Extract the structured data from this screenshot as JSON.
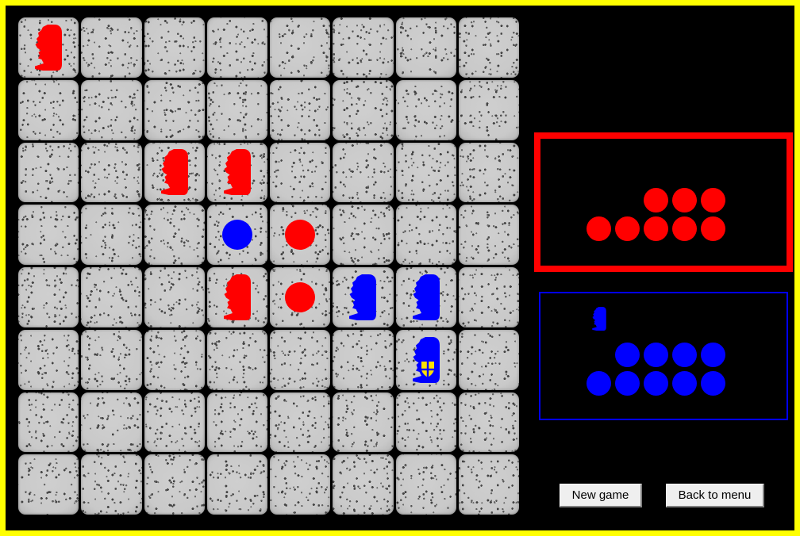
{
  "window": {
    "title": "Moai Board Game",
    "background_color": "#000000",
    "frame_color": "#ffff00"
  },
  "board": {
    "name": "game-board",
    "rows": 8,
    "columns": 8,
    "tile_color": "#c9c9c9",
    "tile_texture": "speckled-stone",
    "cells": [
      [
        {
          "piece": "moai",
          "color": "red"
        },
        null,
        null,
        null,
        null,
        null,
        null,
        null
      ],
      [
        null,
        null,
        null,
        null,
        null,
        null,
        null,
        null
      ],
      [
        null,
        null,
        {
          "piece": "moai",
          "color": "red"
        },
        {
          "piece": "moai",
          "color": "red"
        },
        null,
        null,
        null,
        null
      ],
      [
        null,
        null,
        null,
        {
          "piece": "disc",
          "color": "blue"
        },
        {
          "piece": "disc",
          "color": "red"
        },
        null,
        null,
        null
      ],
      [
        null,
        null,
        null,
        {
          "piece": "moai",
          "color": "red"
        },
        {
          "piece": "disc",
          "color": "red"
        },
        {
          "piece": "moai",
          "color": "blue"
        },
        {
          "piece": "moai",
          "color": "blue"
        },
        null
      ],
      [
        null,
        null,
        null,
        null,
        null,
        null,
        {
          "piece": "moai",
          "color": "blue",
          "badge": "shield"
        },
        null
      ],
      [
        null,
        null,
        null,
        null,
        null,
        null,
        null,
        null
      ],
      [
        null,
        null,
        null,
        null,
        null,
        null,
        null,
        null
      ]
    ]
  },
  "trays": {
    "red": {
      "name": "red-player-tray",
      "border_color": "#ff0000",
      "border_width": 8,
      "disc_color": "#ff0000",
      "disc_count": 8,
      "moai_count": 0,
      "rows": [
        {
          "offset": 3,
          "count": 3
        },
        {
          "offset": 1,
          "count": 5
        }
      ]
    },
    "blue": {
      "name": "blue-player-tray",
      "border_color": "#0000ff",
      "border_width": 2,
      "disc_color": "#0000ff",
      "disc_count": 9,
      "moai_count": 1,
      "rows": [
        {
          "offset": 2,
          "count": 4
        },
        {
          "offset": 1,
          "count": 5
        }
      ]
    }
  },
  "controls": {
    "new_game_label": "New game",
    "back_to_menu_label": "Back to menu"
  },
  "colors": {
    "red": "#ff0000",
    "blue": "#0000ff",
    "yellow": "#ffff00",
    "shield_fill": "#ffe000",
    "background": "#000000",
    "tile": "#c9c9c9"
  }
}
